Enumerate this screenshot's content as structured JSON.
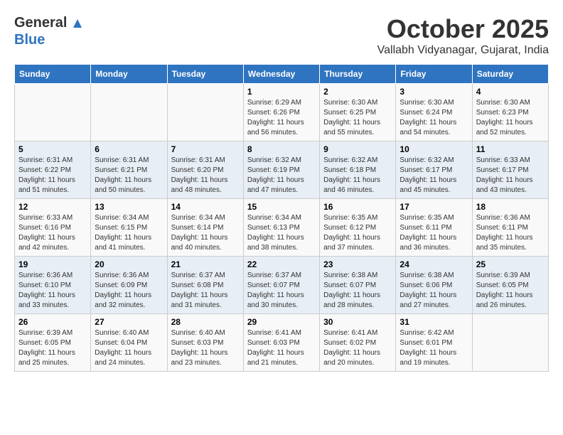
{
  "header": {
    "logo_general": "General",
    "logo_blue": "Blue",
    "month": "October 2025",
    "location": "Vallabh Vidyanagar, Gujarat, India"
  },
  "weekdays": [
    "Sunday",
    "Monday",
    "Tuesday",
    "Wednesday",
    "Thursday",
    "Friday",
    "Saturday"
  ],
  "weeks": [
    [
      {
        "day": "",
        "info": ""
      },
      {
        "day": "",
        "info": ""
      },
      {
        "day": "",
        "info": ""
      },
      {
        "day": "1",
        "info": "Sunrise: 6:29 AM\nSunset: 6:26 PM\nDaylight: 11 hours and 56 minutes."
      },
      {
        "day": "2",
        "info": "Sunrise: 6:30 AM\nSunset: 6:25 PM\nDaylight: 11 hours and 55 minutes."
      },
      {
        "day": "3",
        "info": "Sunrise: 6:30 AM\nSunset: 6:24 PM\nDaylight: 11 hours and 54 minutes."
      },
      {
        "day": "4",
        "info": "Sunrise: 6:30 AM\nSunset: 6:23 PM\nDaylight: 11 hours and 52 minutes."
      }
    ],
    [
      {
        "day": "5",
        "info": "Sunrise: 6:31 AM\nSunset: 6:22 PM\nDaylight: 11 hours and 51 minutes."
      },
      {
        "day": "6",
        "info": "Sunrise: 6:31 AM\nSunset: 6:21 PM\nDaylight: 11 hours and 50 minutes."
      },
      {
        "day": "7",
        "info": "Sunrise: 6:31 AM\nSunset: 6:20 PM\nDaylight: 11 hours and 48 minutes."
      },
      {
        "day": "8",
        "info": "Sunrise: 6:32 AM\nSunset: 6:19 PM\nDaylight: 11 hours and 47 minutes."
      },
      {
        "day": "9",
        "info": "Sunrise: 6:32 AM\nSunset: 6:18 PM\nDaylight: 11 hours and 46 minutes."
      },
      {
        "day": "10",
        "info": "Sunrise: 6:32 AM\nSunset: 6:17 PM\nDaylight: 11 hours and 45 minutes."
      },
      {
        "day": "11",
        "info": "Sunrise: 6:33 AM\nSunset: 6:17 PM\nDaylight: 11 hours and 43 minutes."
      }
    ],
    [
      {
        "day": "12",
        "info": "Sunrise: 6:33 AM\nSunset: 6:16 PM\nDaylight: 11 hours and 42 minutes."
      },
      {
        "day": "13",
        "info": "Sunrise: 6:34 AM\nSunset: 6:15 PM\nDaylight: 11 hours and 41 minutes."
      },
      {
        "day": "14",
        "info": "Sunrise: 6:34 AM\nSunset: 6:14 PM\nDaylight: 11 hours and 40 minutes."
      },
      {
        "day": "15",
        "info": "Sunrise: 6:34 AM\nSunset: 6:13 PM\nDaylight: 11 hours and 38 minutes."
      },
      {
        "day": "16",
        "info": "Sunrise: 6:35 AM\nSunset: 6:12 PM\nDaylight: 11 hours and 37 minutes."
      },
      {
        "day": "17",
        "info": "Sunrise: 6:35 AM\nSunset: 6:11 PM\nDaylight: 11 hours and 36 minutes."
      },
      {
        "day": "18",
        "info": "Sunrise: 6:36 AM\nSunset: 6:11 PM\nDaylight: 11 hours and 35 minutes."
      }
    ],
    [
      {
        "day": "19",
        "info": "Sunrise: 6:36 AM\nSunset: 6:10 PM\nDaylight: 11 hours and 33 minutes."
      },
      {
        "day": "20",
        "info": "Sunrise: 6:36 AM\nSunset: 6:09 PM\nDaylight: 11 hours and 32 minutes."
      },
      {
        "day": "21",
        "info": "Sunrise: 6:37 AM\nSunset: 6:08 PM\nDaylight: 11 hours and 31 minutes."
      },
      {
        "day": "22",
        "info": "Sunrise: 6:37 AM\nSunset: 6:07 PM\nDaylight: 11 hours and 30 minutes."
      },
      {
        "day": "23",
        "info": "Sunrise: 6:38 AM\nSunset: 6:07 PM\nDaylight: 11 hours and 28 minutes."
      },
      {
        "day": "24",
        "info": "Sunrise: 6:38 AM\nSunset: 6:06 PM\nDaylight: 11 hours and 27 minutes."
      },
      {
        "day": "25",
        "info": "Sunrise: 6:39 AM\nSunset: 6:05 PM\nDaylight: 11 hours and 26 minutes."
      }
    ],
    [
      {
        "day": "26",
        "info": "Sunrise: 6:39 AM\nSunset: 6:05 PM\nDaylight: 11 hours and 25 minutes."
      },
      {
        "day": "27",
        "info": "Sunrise: 6:40 AM\nSunset: 6:04 PM\nDaylight: 11 hours and 24 minutes."
      },
      {
        "day": "28",
        "info": "Sunrise: 6:40 AM\nSunset: 6:03 PM\nDaylight: 11 hours and 23 minutes."
      },
      {
        "day": "29",
        "info": "Sunrise: 6:41 AM\nSunset: 6:03 PM\nDaylight: 11 hours and 21 minutes."
      },
      {
        "day": "30",
        "info": "Sunrise: 6:41 AM\nSunset: 6:02 PM\nDaylight: 11 hours and 20 minutes."
      },
      {
        "day": "31",
        "info": "Sunrise: 6:42 AM\nSunset: 6:01 PM\nDaylight: 11 hours and 19 minutes."
      },
      {
        "day": "",
        "info": ""
      }
    ]
  ]
}
